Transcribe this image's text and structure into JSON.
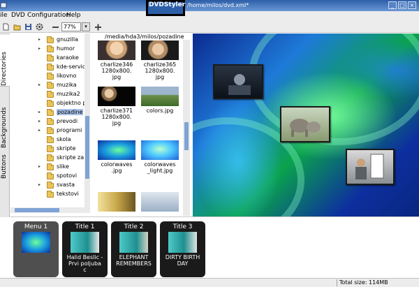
{
  "window": {
    "app_name": "DVDStyler",
    "path": "/home/milos/dvd.xml*",
    "minimize": "_",
    "maximize": "□",
    "close": "×"
  },
  "menu": {
    "items": [
      "ile",
      "DVD",
      "Configuration",
      "Help"
    ]
  },
  "toolbar": {
    "zoom_value": "77%",
    "zoom_dropdown": "▾"
  },
  "tabs": {
    "directories": "Directories",
    "backgrounds": "Backgrounds",
    "buttons": "Buttons"
  },
  "tree": {
    "items": [
      {
        "name": "gnuzilla",
        "arrow": "▸"
      },
      {
        "name": "humor",
        "arrow": "▸"
      },
      {
        "name": "karaoke",
        "arrow": ""
      },
      {
        "name": "kde-service",
        "arrow": ""
      },
      {
        "name": "likovno",
        "arrow": ""
      },
      {
        "name": "muzika",
        "arrow": "▸"
      },
      {
        "name": "muzika2",
        "arrow": ""
      },
      {
        "name": "objektno pr",
        "arrow": ""
      },
      {
        "name": "pozadine",
        "arrow": "▸",
        "selected": true
      },
      {
        "name": "prevodi",
        "arrow": "▸"
      },
      {
        "name": "programi",
        "arrow": "▸"
      },
      {
        "name": "skola",
        "arrow": ""
      },
      {
        "name": "skripte",
        "arrow": ""
      },
      {
        "name": "skripte za a",
        "arrow": ""
      },
      {
        "name": "slike",
        "arrow": "▸"
      },
      {
        "name": "spotovi",
        "arrow": ""
      },
      {
        "name": "svasta",
        "arrow": "▸"
      },
      {
        "name": "tekstovi",
        "arrow": ""
      }
    ]
  },
  "files": {
    "path": "/media/hda3/milos/pozadine",
    "items": [
      {
        "caption": "charlize346\n1280x800.\njpg"
      },
      {
        "caption": "charlize365\n1280x800.\njpg"
      },
      {
        "caption": "charlize371\n1280x800.\njpg"
      },
      {
        "caption": "colors.jpg"
      },
      {
        "caption": "colorwaves\n.jpg"
      },
      {
        "caption": "colorwaves\n_light.jpg"
      },
      {
        "caption": ""
      },
      {
        "caption": ""
      }
    ]
  },
  "titleset": {
    "tiles": [
      {
        "label": "Menu 1",
        "name": ""
      },
      {
        "label": "Title 1",
        "name": "Halid Beslic -\nPrvi poljuba\nc"
      },
      {
        "label": "Title 2",
        "name": "ELEPHANT\nREMEMBERS"
      },
      {
        "label": "Title 3",
        "name": "DIRTY BIRTH\nDAY"
      }
    ]
  },
  "status": {
    "total_size": "Total size: 114MB"
  },
  "colors": {
    "accent": "#2d5fa8",
    "selection": "#a8c2e8",
    "tile_background": "#1a1a1a"
  }
}
